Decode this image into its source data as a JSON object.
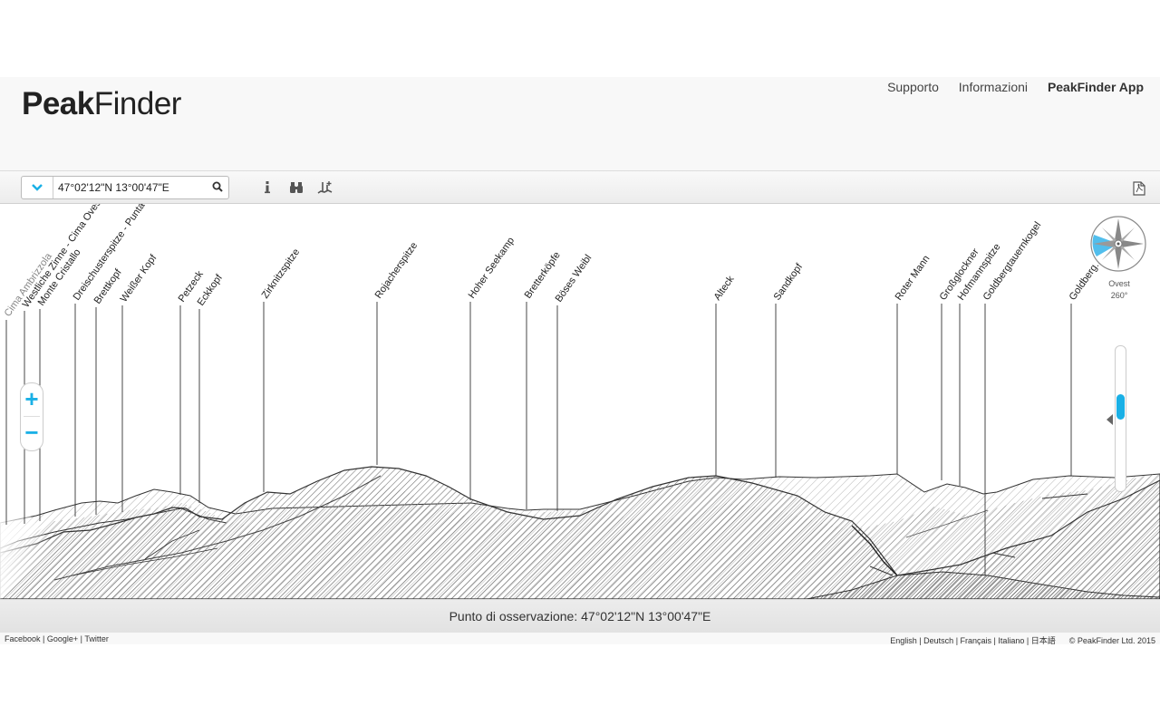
{
  "header": {
    "logo_bold": "Peak",
    "logo_regular": "Finder",
    "nav": [
      "Supporto",
      "Informazioni",
      "PeakFinder App"
    ]
  },
  "toolbar": {
    "coordinates_value": "47°02'12\"N 13°00'47\"E",
    "icons": [
      "chevron-down-icon",
      "search-icon",
      "info-icon",
      "binoculars-icon",
      "peaks-icon",
      "pdf-icon"
    ]
  },
  "panorama": {
    "peaks": [
      "Cima Ambrizzola",
      "Westliche Zinne - Cima Ovest",
      "Monte Cristallo",
      "Dreischusterspitze - Punta tre s...",
      "Brettkopf",
      "Weißer Kopf",
      "Petzeck",
      "Eckkopf",
      "Zirknitzspitze",
      "Rojacherspitze",
      "Hoher Seekamp",
      "Bretterköpfe",
      "Böses Weibl",
      "Alteck",
      "Sandkopf",
      "Roter Mann",
      "Großglockner",
      "Hofmannspitze",
      "Goldbergtauernkogel",
      "Goldberg..."
    ],
    "zoom_in": "+",
    "zoom_out": "−",
    "compass": {
      "direction": "Ovest",
      "degrees": "260°"
    }
  },
  "status": {
    "label": "Punto di osservazione: 47°02'12\"N 13°00'47\"E"
  },
  "footer": {
    "social": [
      "Facebook",
      "Google+",
      "Twitter"
    ],
    "languages": [
      "English",
      "Deutsch",
      "Français",
      "Italiano",
      "日本語"
    ],
    "copyright": "© PeakFinder Ltd. 2015"
  },
  "colors": {
    "accent": "#1ab0e6",
    "compass_sector": "#3fb7ea"
  }
}
